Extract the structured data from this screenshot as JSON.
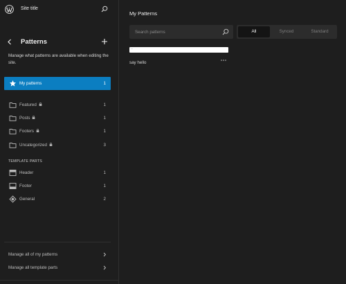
{
  "site_hub": {
    "site_title": "Site title"
  },
  "sidebar": {
    "title": "Patterns",
    "description": "Manage what patterns are available when editing the site.",
    "items": [
      {
        "label": "My patterns",
        "count": "1",
        "icon": "star-icon",
        "active": true,
        "locked": false
      },
      {
        "label": "Featured",
        "count": "1",
        "icon": "folder-icon",
        "active": false,
        "locked": true
      },
      {
        "label": "Posts",
        "count": "1",
        "icon": "folder-icon",
        "active": false,
        "locked": true
      },
      {
        "label": "Footers",
        "count": "1",
        "icon": "folder-icon",
        "active": false,
        "locked": true
      },
      {
        "label": "Uncategorized",
        "count": "3",
        "icon": "folder-icon",
        "active": false,
        "locked": true
      }
    ],
    "template_parts_heading": "TEMPLATE PARTS",
    "template_parts": [
      {
        "label": "Header",
        "count": "1",
        "icon": "header-icon"
      },
      {
        "label": "Footer",
        "count": "1",
        "icon": "footer-icon"
      },
      {
        "label": "General",
        "count": "2",
        "icon": "symbol-icon"
      }
    ],
    "footer_links": [
      {
        "label": "Manage all of my patterns"
      },
      {
        "label": "Manage all template parts"
      }
    ]
  },
  "main": {
    "title": "My Patterns",
    "search": {
      "placeholder": "Search patterns",
      "value": ""
    },
    "filter": {
      "options": [
        "All",
        "Synced",
        "Standard"
      ],
      "selected": "All"
    },
    "patterns": [
      {
        "title": "say hello",
        "preview_text": "..."
      }
    ]
  },
  "colors": {
    "background": "#1e1e1e",
    "accent": "#0b7ec1",
    "surface": "#2c2c2c"
  }
}
